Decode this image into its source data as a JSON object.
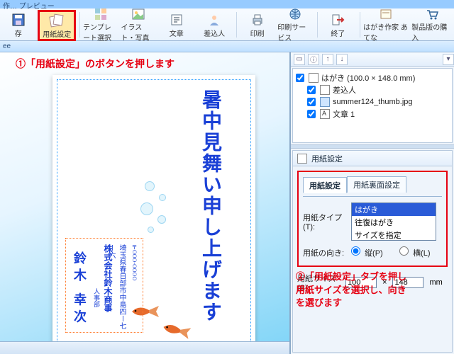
{
  "title_strip": "作… プレビュー",
  "toolbar": [
    {
      "name": "save-button",
      "label": "存",
      "icon": "floppy"
    },
    {
      "name": "paper-settings-button",
      "label": "用紙設定",
      "icon": "pages",
      "highlighted": true
    },
    {
      "name": "template-select-button",
      "label": "テンプレート選択",
      "icon": "grid"
    },
    {
      "name": "illustration-button",
      "label": "イラスト・写真",
      "icon": "picture"
    },
    {
      "name": "text-button",
      "label": "文章",
      "icon": "text"
    },
    {
      "name": "insert-object-button",
      "label": "差込人",
      "icon": "person"
    },
    {
      "name": "print-button",
      "label": "印刷",
      "icon": "printer"
    },
    {
      "name": "print-service-button",
      "label": "印刷サービス",
      "icon": "globe"
    },
    {
      "name": "exit-button",
      "label": "終了",
      "icon": "exit"
    },
    {
      "name": "atena-button",
      "label": "はがき作家 あてな",
      "icon": "card"
    },
    {
      "name": "buy-product-button",
      "label": "製品版の購入",
      "icon": "cart"
    }
  ],
  "substrip": "ee",
  "annotations": {
    "a1": "①「用紙設定」のボタンを押します",
    "a2_l1": "②「用紙設定」タブを押し",
    "a2_l2": "用紙サイズを選択し、向き",
    "a2_l3": "を選びます"
  },
  "postcard": {
    "greeting": "暑中見舞い申し上げます",
    "addr": {
      "line1": "〒OOO-OOOO",
      "line2": "埼玉県春日部市中島四ー七ー六",
      "line3": "株式会社鈴木商事",
      "line4": "人事部",
      "line5": "鈴木 幸次"
    }
  },
  "tree": {
    "root": "はがき (100.0 × 148.0 mm)",
    "items": [
      {
        "name": "tree-item-sashiire",
        "label": "差込人"
      },
      {
        "name": "tree-item-image",
        "label": "summer124_thumb.jpg"
      },
      {
        "name": "tree-item-text",
        "label": "文章 1"
      }
    ]
  },
  "panel": {
    "title": "用紙設定",
    "tabs": {
      "settings": "用紙設定",
      "back": "用紙裏面設定"
    },
    "type_label": "用紙タイプ(T):",
    "type_options": [
      "はがき",
      "往復はがき",
      "サイズを指定"
    ],
    "orient_label": "用紙の向き:",
    "orient_portrait": "縦(P)",
    "orient_landscape": "横(L)",
    "size_label": "用紙サイズ(S):",
    "size_unit": "mm",
    "size_w": "100",
    "size_h": "148"
  }
}
